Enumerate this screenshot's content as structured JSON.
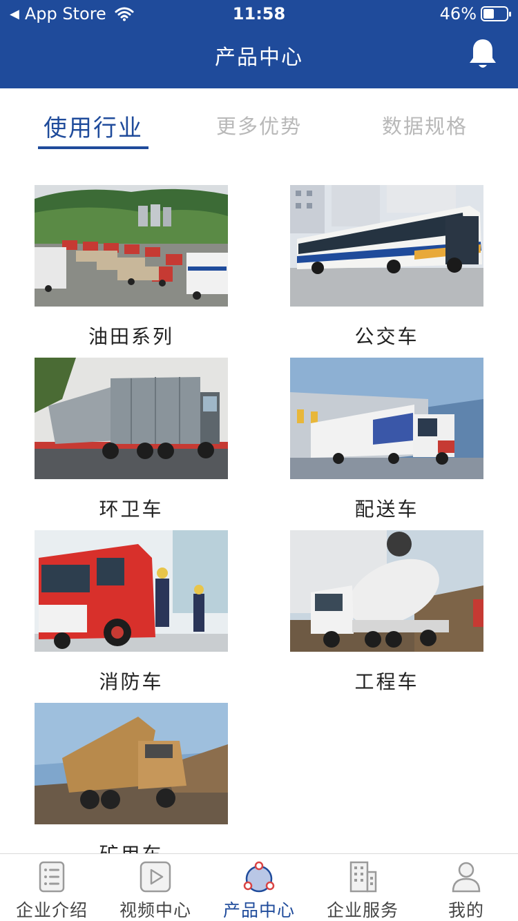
{
  "status_bar": {
    "back_label": "App Store",
    "time": "11:58",
    "battery": "46%",
    "battery_level": 0.46
  },
  "header": {
    "title": "产品中心"
  },
  "segments": [
    {
      "label": "使用行业",
      "active": true
    },
    {
      "label": "更多优势",
      "active": false
    },
    {
      "label": "数据规格",
      "active": false
    }
  ],
  "products": [
    {
      "label": "油田系列"
    },
    {
      "label": "公交车"
    },
    {
      "label": "环卫车"
    },
    {
      "label": "配送车"
    },
    {
      "label": "消防车"
    },
    {
      "label": "工程车"
    },
    {
      "label": "矿用车"
    }
  ],
  "tabbar": [
    {
      "label": "企业介绍",
      "icon": "document-icon",
      "active": false
    },
    {
      "label": "视频中心",
      "icon": "video-icon",
      "active": false
    },
    {
      "label": "产品中心",
      "icon": "product-icon",
      "active": true
    },
    {
      "label": "企业服务",
      "icon": "building-icon",
      "active": false
    },
    {
      "label": "我的",
      "icon": "user-icon",
      "active": false
    }
  ],
  "colors": {
    "primary": "#1f4b9b",
    "inactive_text": "#b8b8b8",
    "accent_red": "#d94444"
  }
}
